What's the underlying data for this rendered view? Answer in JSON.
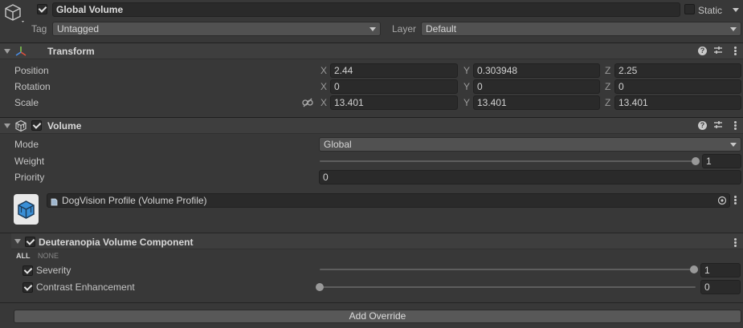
{
  "gameobject": {
    "active": true,
    "name": "Global Volume",
    "static_label": "Static",
    "static_checked": false,
    "tag_label": "Tag",
    "tag_value": "Untagged",
    "layer_label": "Layer",
    "layer_value": "Default"
  },
  "transform": {
    "title": "Transform",
    "rows": [
      {
        "label": "Position",
        "x": "2.44",
        "y": "0.303948",
        "z": "2.25"
      },
      {
        "label": "Rotation",
        "x": "0",
        "y": "0",
        "z": "0"
      },
      {
        "label": "Scale",
        "x": "13.401",
        "y": "13.401",
        "z": "13.401"
      }
    ],
    "axes": {
      "x": "X",
      "y": "Y",
      "z": "Z"
    }
  },
  "volume": {
    "title": "Volume",
    "enabled": true,
    "mode_label": "Mode",
    "mode_value": "Global",
    "weight_label": "Weight",
    "weight_value": "1",
    "weight_fraction": 1.0,
    "priority_label": "Priority",
    "priority_value": "0",
    "profile_value": "DogVision Profile (Volume Profile)"
  },
  "component": {
    "title": "Deuteranopia Volume Component",
    "enabled": true,
    "all_label": "ALL",
    "none_label": "NONE",
    "params": [
      {
        "label": "Severity",
        "checked": true,
        "value": "1",
        "fraction": 1.0
      },
      {
        "label": "Contrast Enhancement",
        "checked": true,
        "value": "0",
        "fraction": 0.0
      }
    ]
  },
  "add_override_label": "Add Override",
  "colors": {
    "background": "#383838",
    "header": "#3e3e3e",
    "field": "#2a2a2a",
    "dropdown": "#515151",
    "text": "#c4c4c4"
  }
}
